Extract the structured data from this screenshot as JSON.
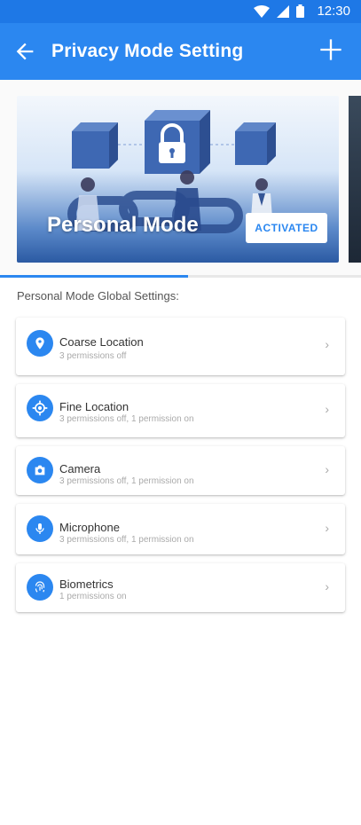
{
  "status_bar": {
    "time": "12:30"
  },
  "app_bar": {
    "title": "Privacy Mode Setting"
  },
  "mode_card": {
    "name": "Personal Mode",
    "badge": "ACTIVATED"
  },
  "section_label": "Personal Mode Global Settings:",
  "permissions": [
    {
      "name": "Coarse Location",
      "status": "3 permissions off",
      "icon": "location-pin-icon"
    },
    {
      "name": "Fine Location",
      "status": "3 permissions off, 1 permission on",
      "icon": "crosshair-icon"
    },
    {
      "name": "Camera",
      "status": "3 permissions off, 1 permission on",
      "icon": "camera-icon"
    },
    {
      "name": "Microphone",
      "status": "3 permissions off, 1 permission on",
      "icon": "microphone-icon"
    },
    {
      "name": "Biometrics",
      "status": "1 permissions on",
      "icon": "fingerprint-icon"
    }
  ],
  "colors": {
    "primary": "#2b87f0",
    "status_bar": "#1e78e6"
  }
}
